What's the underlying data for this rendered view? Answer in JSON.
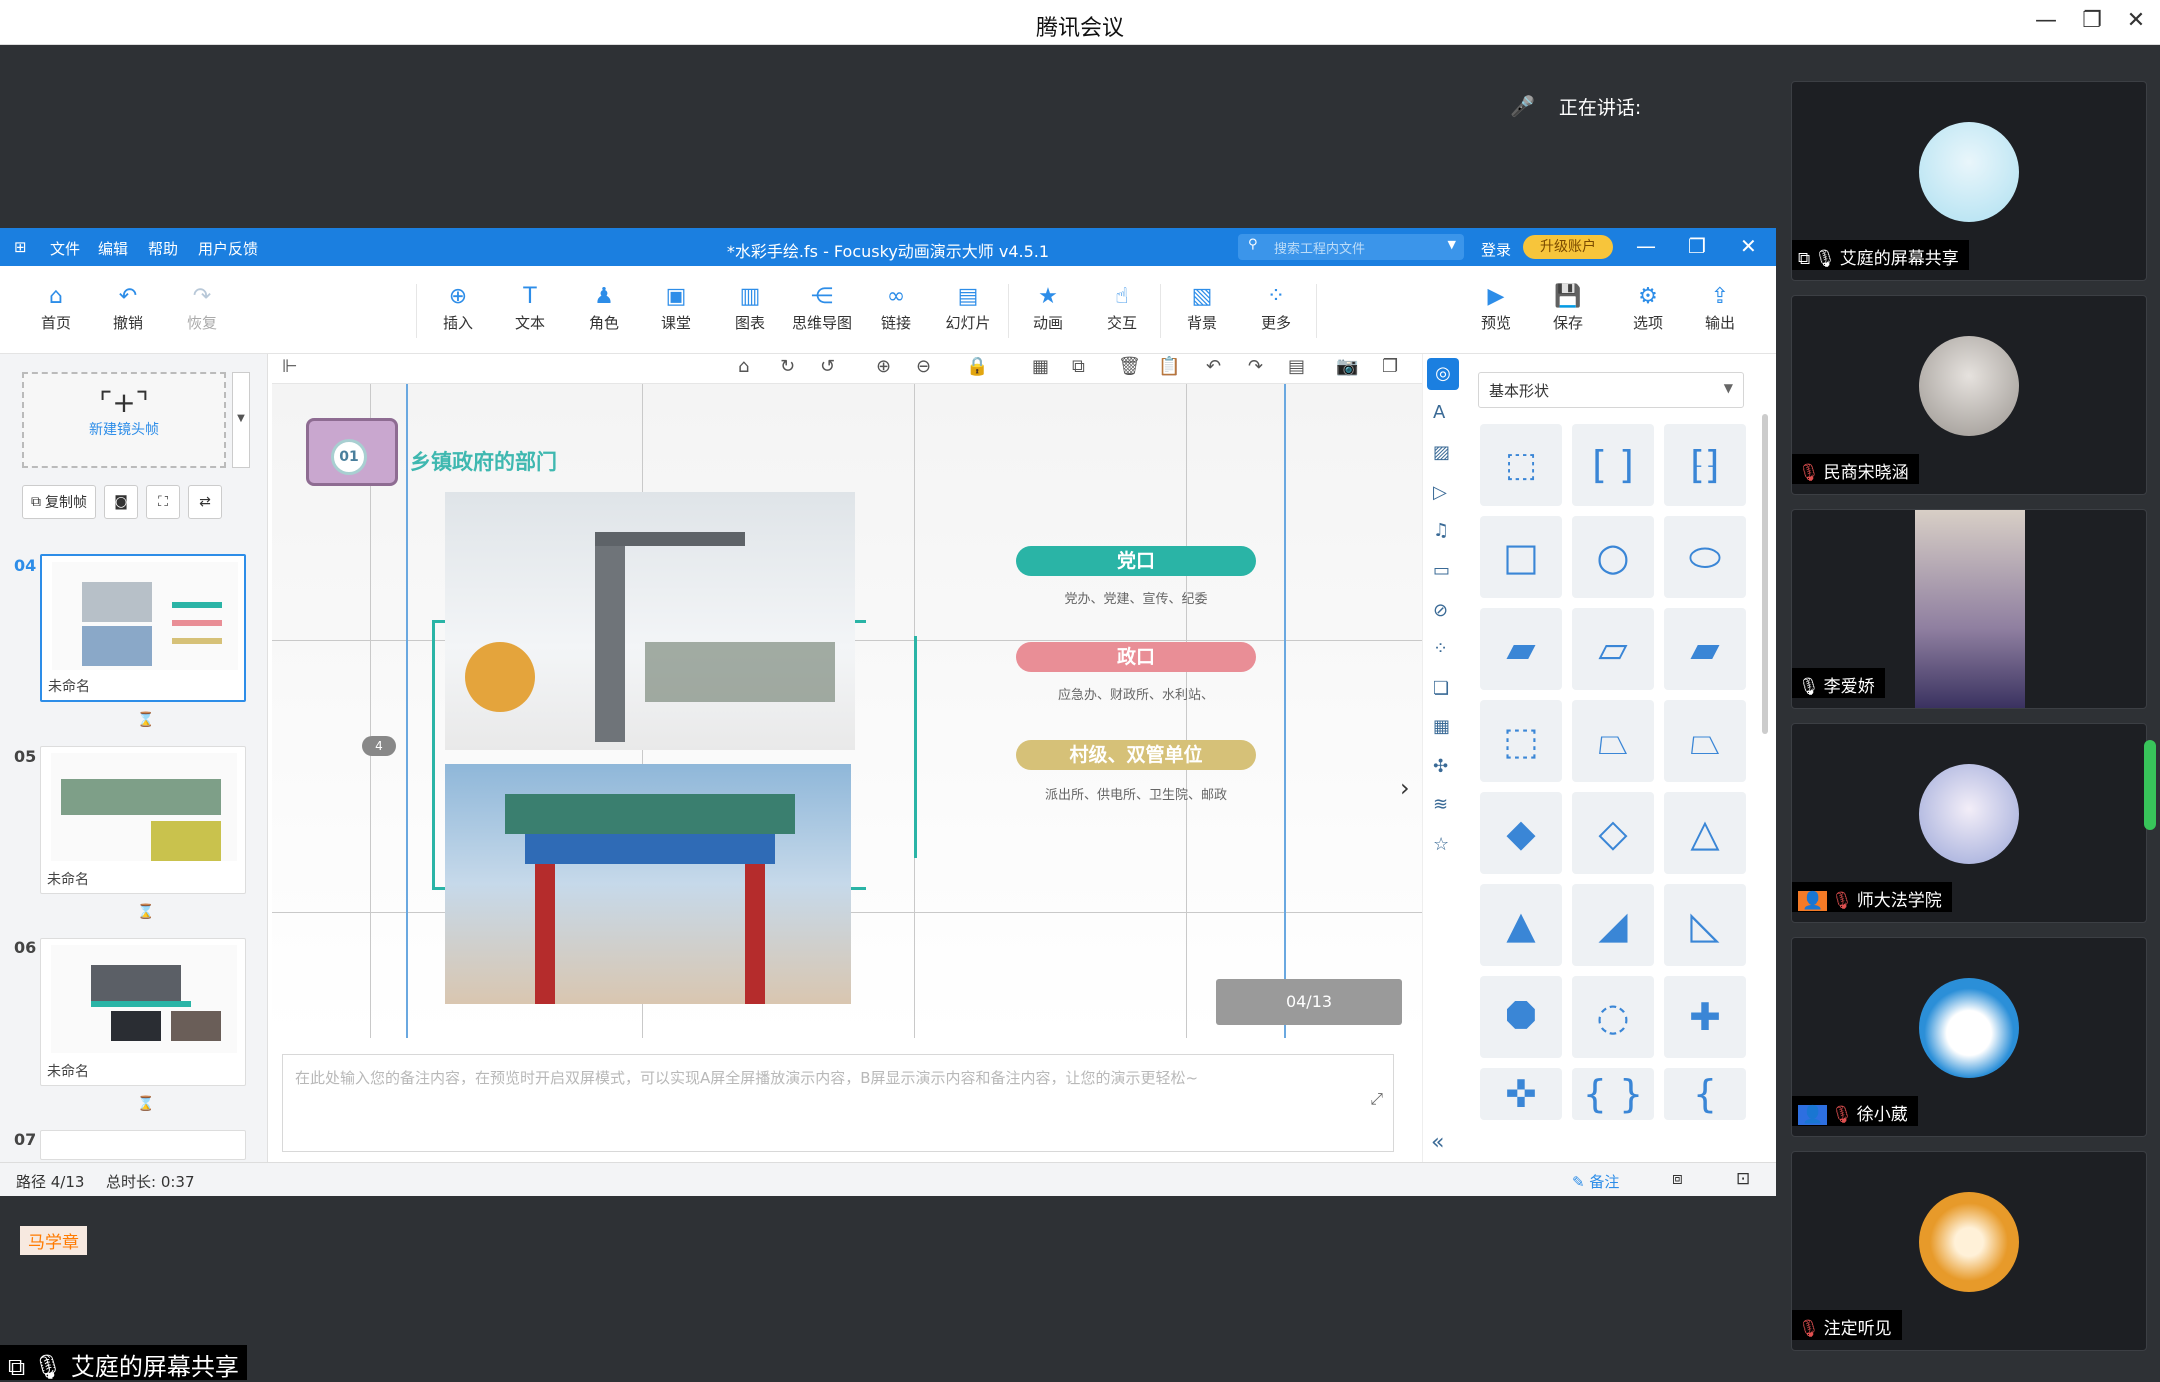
{
  "window": {
    "title": "腾讯会议"
  },
  "speaking": {
    "label": "正在讲话:"
  },
  "focusky": {
    "menu": [
      "文件",
      "编辑",
      "帮助",
      "用户反馈"
    ],
    "title": "*水彩手绘.fs - Focusky动画演示大师  v4.5.1",
    "search_placeholder": "搜索工程内文件",
    "login": "登录",
    "upgrade": "升级账户",
    "ribbon": {
      "home": "首页",
      "undo": "撤销",
      "redo": "恢复",
      "insert": "插入",
      "text": "文本",
      "role": "角色",
      "class": "课堂",
      "chart": "图表",
      "mindmap": "思维导图",
      "link": "链接",
      "slide": "幻灯片",
      "animation": "动画",
      "interact": "交互",
      "background": "背景",
      "more": "更多",
      "preview": "预览",
      "save": "保存",
      "options": "选项",
      "output": "输出"
    },
    "panel": {
      "new_frame": "新建镜头帧",
      "copy_frame": "复制帧",
      "slides": [
        {
          "num": "04",
          "name": "未命名"
        },
        {
          "num": "05",
          "name": "未命名"
        },
        {
          "num": "06",
          "name": "未命名"
        },
        {
          "num": "07",
          "name": ""
        }
      ],
      "cursor_user": "马学章"
    },
    "slide": {
      "badge": "01",
      "title": "乡镇政府的部门",
      "pin": "4",
      "sections": [
        {
          "title": "党口",
          "sub": "党办、党建、宣传、纪委",
          "color": "#2ab4a6"
        },
        {
          "title": "政口",
          "sub": "应急办、财政所、水利站、",
          "color": "#e98e96"
        },
        {
          "title": "村级、双管单位",
          "sub": "派出所、供电所、卫生院、邮政",
          "color": "#d6c178"
        }
      ],
      "page": "04/13"
    },
    "notes_placeholder": "在此处输入您的备注内容，在预览时开启双屏模式，可以实现A屏全屏播放演示内容，B屏显示演示内容和备注内容，让您的演示更轻松~",
    "shapes": {
      "category": "基本形状"
    },
    "status": {
      "path": "路径 4/13",
      "duration": "总时长: 0:37",
      "notes": "备注"
    }
  },
  "participants": [
    {
      "name": "艾庭的屏幕共享",
      "muted": false,
      "share": true
    },
    {
      "name": "民商宋晓涵",
      "muted": true
    },
    {
      "name": "李爱娇",
      "muted": false
    },
    {
      "name": "师大法学院",
      "muted": true,
      "badge": true
    },
    {
      "name": "徐小葳",
      "muted": true,
      "badge": true
    },
    {
      "name": "注定听见",
      "muted": true
    }
  ],
  "bottom_share": "艾庭的屏幕共享",
  "colors": {
    "brand": "#1b7fe0",
    "teal": "#2ab4a6",
    "upgrade": "#f7c53b"
  }
}
